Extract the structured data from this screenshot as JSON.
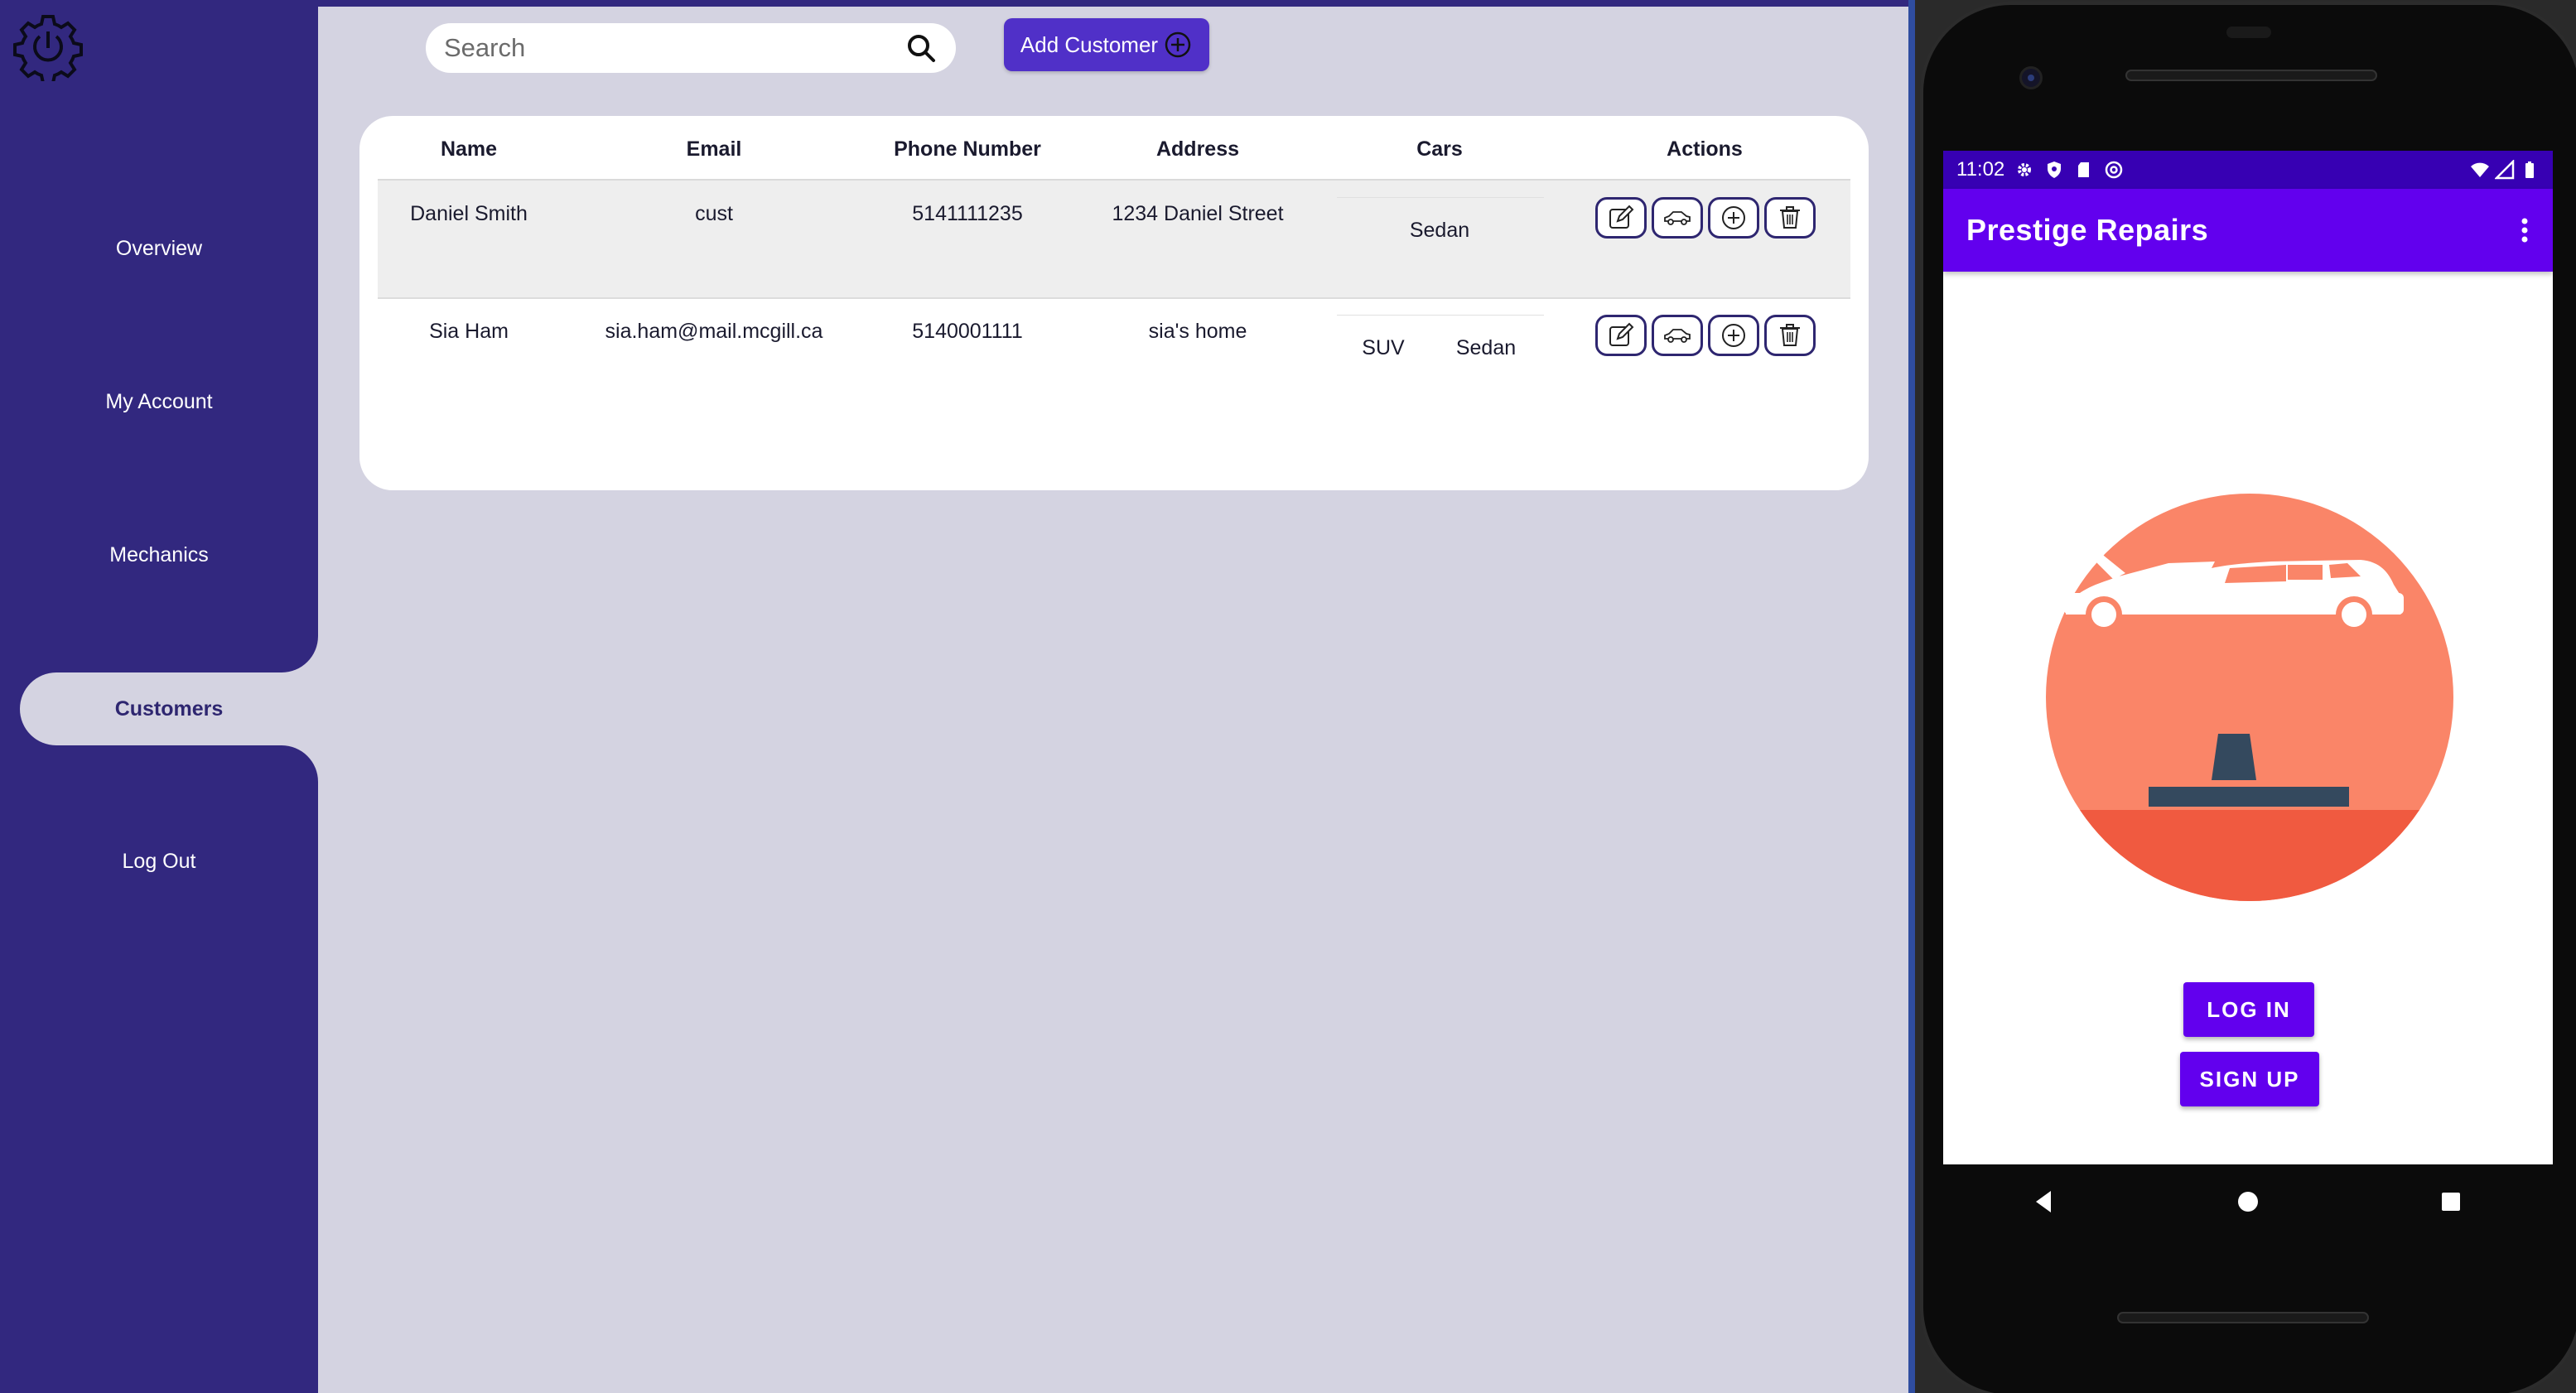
{
  "sidebar": {
    "items": [
      {
        "label": "Overview"
      },
      {
        "label": "My Account"
      },
      {
        "label": "Mechanics"
      },
      {
        "label": "Customers",
        "active": true
      },
      {
        "label": "Log Out"
      }
    ]
  },
  "toolbar": {
    "search_placeholder": "Search",
    "add_label": "Add Customer"
  },
  "table": {
    "headers": [
      "Name",
      "Email",
      "Phone Number",
      "Address",
      "Cars",
      "Actions"
    ],
    "rows": [
      {
        "name": "Daniel Smith",
        "email": "cust",
        "phone": "5141111235",
        "address": "1234 Daniel Street",
        "cars": [
          "Sedan"
        ]
      },
      {
        "name": "Sia Ham",
        "email": "sia.ham@mail.mcgill.ca",
        "phone": "5140001111",
        "address": "sia's home",
        "cars": [
          "SUV",
          "Sedan"
        ]
      }
    ],
    "action_icons": [
      "edit-icon",
      "car-icon",
      "add-circle-icon",
      "trash-icon"
    ]
  },
  "phone": {
    "status_time": "11:02",
    "app_title": "Prestige Repairs",
    "login_label": "LOG IN",
    "signup_label": "SIGN UP"
  },
  "colors": {
    "sidebar": "#32287f",
    "background": "#d4d3e1",
    "accent": "#5030c8",
    "app_primary": "#6200ee",
    "status_bar": "#3700b3",
    "illustration_circle": "#fa8568",
    "illustration_ground": "#f05a40"
  }
}
